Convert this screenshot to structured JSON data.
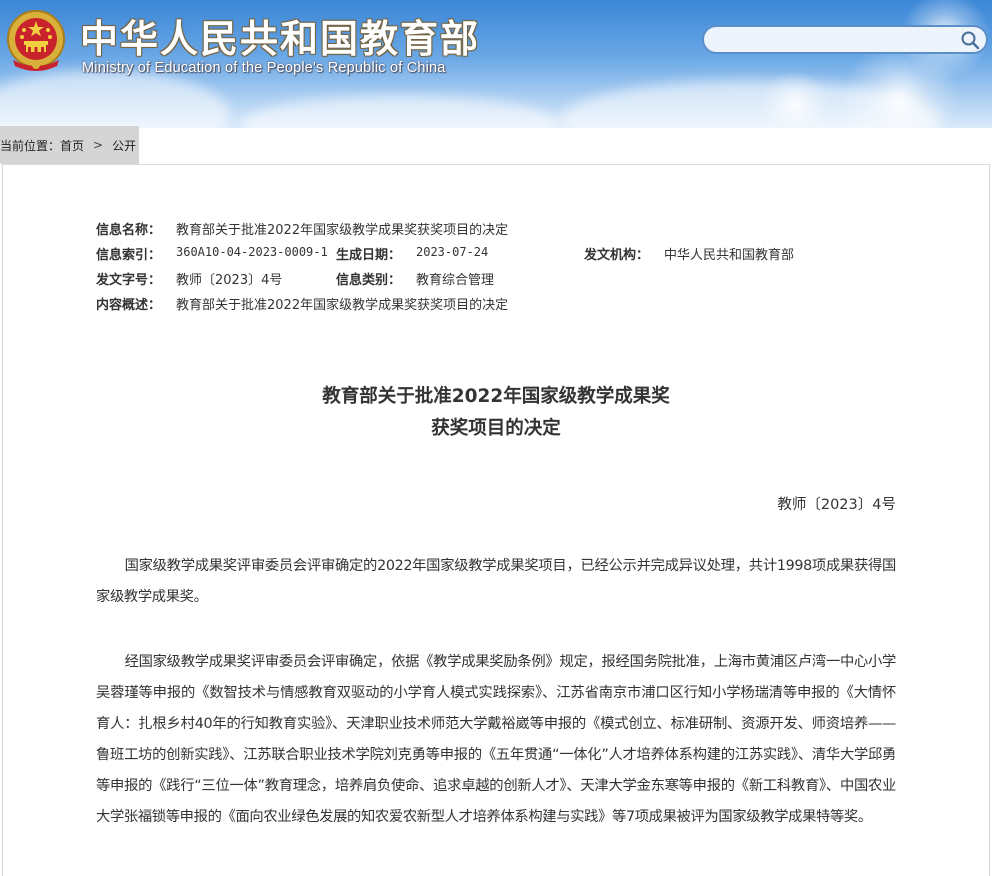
{
  "header": {
    "title_cn": "中华人民共和国教育部",
    "title_en": "Ministry of Education of the People's Republic of China",
    "search": {
      "value": "",
      "placeholder": ""
    }
  },
  "breadcrumb": {
    "prefix": "当前位置：",
    "home": "首页",
    "separator": ">",
    "current": "公开"
  },
  "info": {
    "name_label": "信息名称：",
    "name_value": "教育部关于批准2022年国家级教学成果奖获奖项目的决定",
    "index_label": "信息索引：",
    "index_value": "360A10-04-2023-0009-1",
    "date_label": "生成日期：",
    "date_value": "2023-07-24",
    "org_label": "发文机构：",
    "org_value": "中华人民共和国教育部",
    "docnum_label": "发文字号：",
    "docnum_value": "教师〔2023〕4号",
    "category_label": "信息类别：",
    "category_value": "教育综合管理",
    "summary_label": "内容概述：",
    "summary_value": "教育部关于批准2022年国家级教学成果奖获奖项目的决定"
  },
  "article": {
    "title_line1": "教育部关于批准2022年国家级教学成果奖",
    "title_line2": "获奖项目的决定",
    "doc_number": "教师〔2023〕4号",
    "paragraph1": "国家级教学成果奖评审委员会评审确定的2022年国家级教学成果奖项目，已经公示并完成异议处理，共计1998项成果获得国家级教学成果奖。",
    "paragraph2": "经国家级教学成果奖评审委员会评审确定，依据《教学成果奖励条例》规定，报经国务院批准，上海市黄浦区卢湾一中心小学吴蓉瑾等申报的《数智技术与情感教育双驱动的小学育人模式实践探索》、江苏省南京市浦口区行知小学杨瑞清等申报的《大情怀育人：扎根乡村40年的行知教育实验》、天津职业技术师范大学戴裕崴等申报的《模式创立、标准研制、资源开发、师资培养——鲁班工坊的创新实践》、江苏联合职业技术学院刘克勇等申报的《五年贯通“一体化”人才培养体系构建的江苏实践》、清华大学邱勇等申报的《践行“三位一体”教育理念，培养肩负使命、追求卓越的创新人才》、天津大学金东寒等申报的《新工科教育》、中国农业大学张福锁等申报的《面向农业绿色发展的知农爱农新型人才培养体系构建与实践》等7项成果被评为国家级教学成果特等奖。"
  }
}
